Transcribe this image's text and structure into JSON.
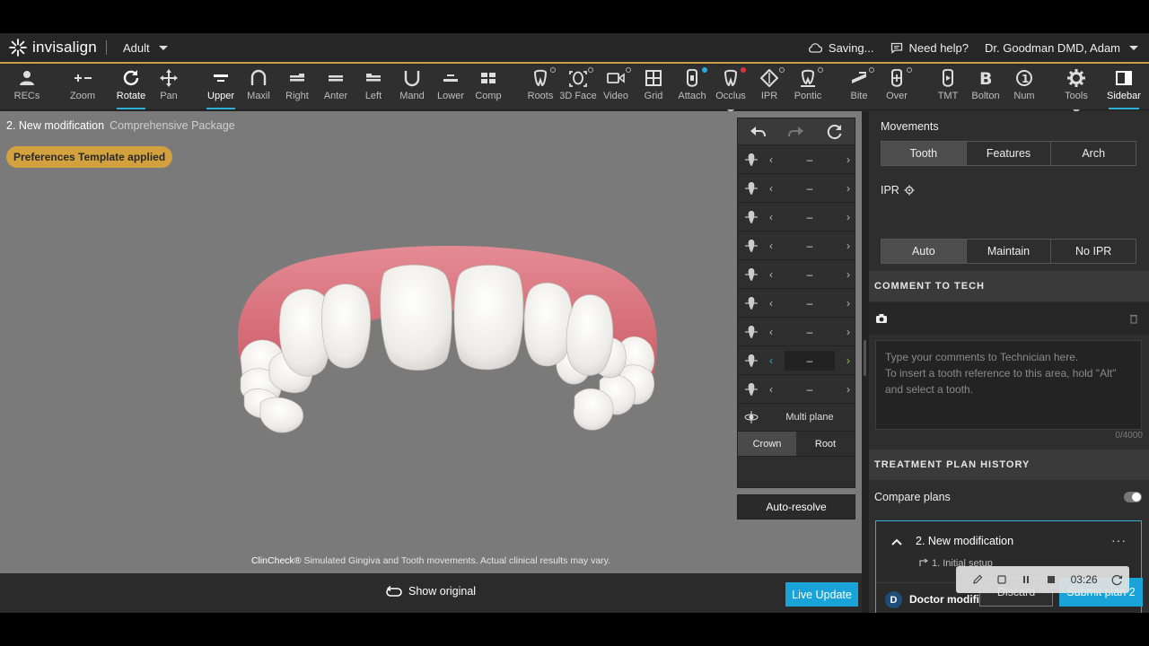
{
  "header": {
    "brand": "invisalign",
    "patient_type": "Adult",
    "saving": "Saving...",
    "help": "Need help?",
    "doctor": "Dr. Goodman DMD, Adam"
  },
  "toolbar": [
    {
      "label": "RECs",
      "icon": "person-icon"
    },
    {
      "label": "Zoom",
      "icon": "zoom-in-out-icon"
    },
    {
      "label": "Rotate",
      "icon": "rotate-icon",
      "active": true
    },
    {
      "label": "Pan",
      "icon": "pan-icon"
    },
    {
      "label": "Upper",
      "icon": "upper-arch-icon",
      "active": true
    },
    {
      "label": "Maxil",
      "icon": "maxillary-icon"
    },
    {
      "label": "Right",
      "icon": "right-view-icon"
    },
    {
      "label": "Anter",
      "icon": "anterior-view-icon"
    },
    {
      "label": "Left",
      "icon": "left-view-icon"
    },
    {
      "label": "Mand",
      "icon": "mandibular-icon"
    },
    {
      "label": "Lower",
      "icon": "lower-arch-icon"
    },
    {
      "label": "Comp",
      "icon": "compare-icon"
    },
    {
      "label": "Roots",
      "icon": "tooth-roots-icon"
    },
    {
      "label": "3D Face",
      "icon": "face-3d-icon"
    },
    {
      "label": "Video",
      "icon": "video-icon"
    },
    {
      "label": "Grid",
      "icon": "grid-icon"
    },
    {
      "label": "Attach",
      "icon": "attachment-icon"
    },
    {
      "label": "Occlus",
      "icon": "occlusion-icon"
    },
    {
      "label": "IPR",
      "icon": "ipr-icon"
    },
    {
      "label": "Pontic",
      "icon": "pontic-icon"
    },
    {
      "label": "Bite",
      "icon": "bite-icon"
    },
    {
      "label": "Over",
      "icon": "overjet-icon"
    },
    {
      "label": "TMT",
      "icon": "tmt-icon"
    },
    {
      "label": "Bolton",
      "icon": "bolton-icon"
    },
    {
      "label": "Num",
      "icon": "numbering-icon"
    },
    {
      "label": "Tools",
      "icon": "gear-icon"
    },
    {
      "label": "Sidebar",
      "icon": "sidebar-icon",
      "active": true
    }
  ],
  "viewport": {
    "title": "2. New modification",
    "package": "Comprehensive Package",
    "badge": "Preferences Template applied",
    "disclaimer_brand": "ClinCheck®",
    "disclaimer_text": " Simulated Gingiva and Tooth movements. Actual clinical results may vary."
  },
  "movement_panel": {
    "rows": [
      {
        "icon": "extrusion-icon",
        "value": "–"
      },
      {
        "icon": "angulation-icon",
        "value": "–"
      },
      {
        "icon": "mesial-distal-icon",
        "value": "–"
      },
      {
        "icon": "rotation-axis-icon",
        "value": "–"
      },
      {
        "icon": "buccal-lingual-icon",
        "value": "–"
      },
      {
        "icon": "inclination-icon",
        "value": "–"
      },
      {
        "icon": "root-torque-icon",
        "value": "–"
      },
      {
        "icon": "tip-icon",
        "value": "–",
        "highlighted": true
      },
      {
        "icon": "intrusion-icon",
        "value": "–"
      }
    ],
    "multi_plane": "Multi plane",
    "crown": "Crown",
    "root": "Root",
    "auto_resolve": "Auto-resolve"
  },
  "bottom": {
    "show_original": "Show original",
    "live_update": "Live Update"
  },
  "sidebar": {
    "movements_label": "Movements",
    "movements_options": [
      "Tooth",
      "Features",
      "Arch"
    ],
    "ipr_label": "IPR",
    "ipr_options": [
      "Auto",
      "Maintain",
      "No IPR"
    ],
    "comment_head": "COMMENT TO TECH",
    "comment_placeholder_1": "Type your comments to Technician here.",
    "comment_placeholder_2": "To insert a tooth reference to this area, hold \"Alt\" and select a tooth.",
    "char_count": "0/4000",
    "history_head": "TREATMENT PLAN HISTORY",
    "compare_plans": "Compare plans",
    "plan_name": "2. New modification",
    "plan_parent": "1. Initial setup",
    "doc_badge": "D",
    "doctor_mods": "Doctor modifications",
    "discard": "Discard",
    "submit": "Submit plan 2"
  },
  "recorder": {
    "time": "03:26"
  },
  "colors": {
    "accent": "#1aa3d8",
    "header_border": "#c7a046",
    "badge": "#d3a13d",
    "viewport": "#7a7a7a",
    "gingiva": "#d96a76"
  }
}
